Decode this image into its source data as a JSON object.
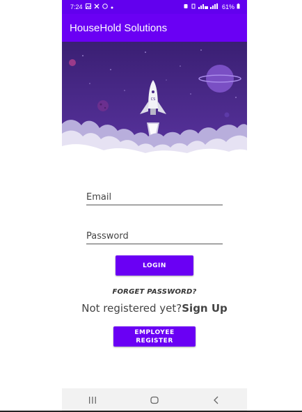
{
  "status_bar": {
    "time": "7:24",
    "battery": "61%"
  },
  "app_bar": {
    "title": "HouseHold Solutions"
  },
  "banner": {
    "rocket_label": "CS"
  },
  "form": {
    "email_placeholder": "Email",
    "password_placeholder": "Password",
    "login_label": "LOGIN",
    "forgot_label": "FORGET PASSWORD?",
    "not_registered_text": "Not registered yet?",
    "sign_up_label": "Sign Up",
    "employee_register_label": "EMPLOYEE REGISTER"
  },
  "nav_bar": {
    "items": [
      "recent-apps",
      "home",
      "back"
    ]
  },
  "colors": {
    "primary": "#6a00f4",
    "status_bar": "#6200ee",
    "banner_sky": "#4b2a8a",
    "planet": "#7a4fc4"
  }
}
